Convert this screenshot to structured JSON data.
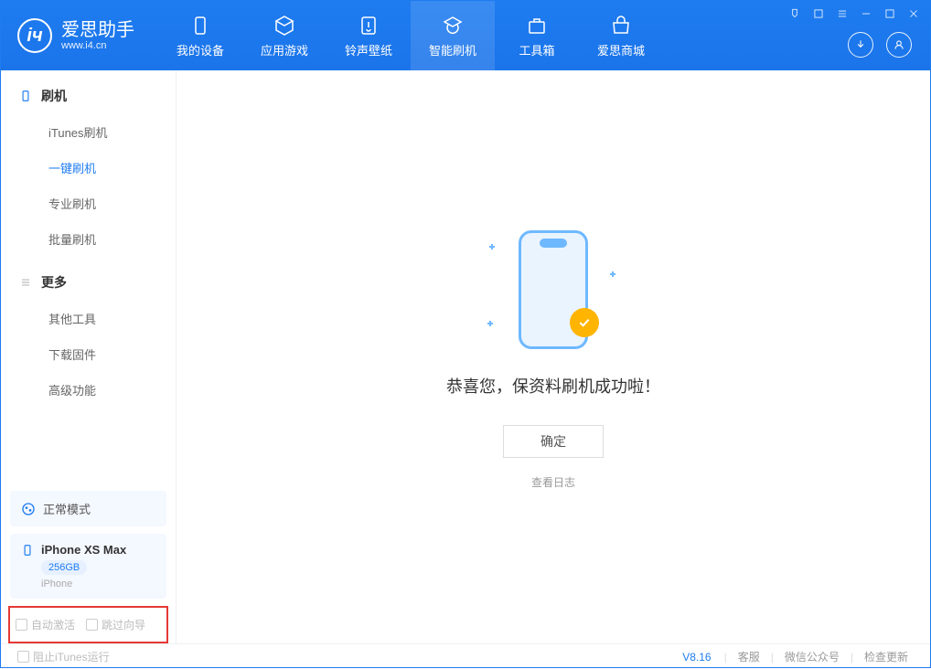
{
  "app": {
    "title": "爱思助手",
    "subtitle": "www.i4.cn"
  },
  "nav": {
    "items": [
      {
        "label": "我的设备"
      },
      {
        "label": "应用游戏"
      },
      {
        "label": "铃声壁纸"
      },
      {
        "label": "智能刷机"
      },
      {
        "label": "工具箱"
      },
      {
        "label": "爱思商城"
      }
    ]
  },
  "sidebar": {
    "group1": {
      "title": "刷机",
      "items": [
        "iTunes刷机",
        "一键刷机",
        "专业刷机",
        "批量刷机"
      ]
    },
    "group2": {
      "title": "更多",
      "items": [
        "其他工具",
        "下载固件",
        "高级功能"
      ]
    }
  },
  "device_panel": {
    "status": "正常模式",
    "name": "iPhone XS Max",
    "capacity": "256GB",
    "type": "iPhone"
  },
  "checkboxes": {
    "auto_activate": "自动激活",
    "skip_guide": "跳过向导"
  },
  "main": {
    "success_text": "恭喜您，保资料刷机成功啦！",
    "confirm_button": "确定",
    "view_log": "查看日志"
  },
  "footer": {
    "block_itunes": "阻止iTunes运行",
    "version": "V8.16",
    "links": [
      "客服",
      "微信公众号",
      "检查更新"
    ]
  }
}
